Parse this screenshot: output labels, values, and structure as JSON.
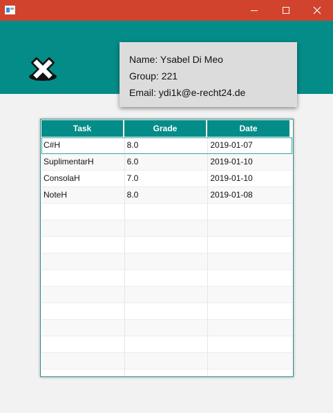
{
  "window": {
    "controls": {
      "minimize": "minimize-icon",
      "maximize": "maximize-icon",
      "close": "close-icon"
    }
  },
  "header": {
    "logo_icon": "x-mark-logo-icon",
    "accent_color": "#048c88",
    "titlebar_color": "#d1432c"
  },
  "student": {
    "name": "Name: Ysabel Di Meo",
    "group": "Group: 221",
    "email": "Email: ydi1k@e-recht24.de"
  },
  "table": {
    "columns": [
      "Task",
      "Grade",
      "Date"
    ],
    "rows": [
      {
        "task": "C#H",
        "grade": "8.0",
        "date": "2019-01-07"
      },
      {
        "task": "SuplimentarH",
        "grade": "6.0",
        "date": "2019-01-10"
      },
      {
        "task": "ConsolaH",
        "grade": "7.0",
        "date": "2019-01-10"
      },
      {
        "task": "NoteH",
        "grade": "8.0",
        "date": "2019-01-08"
      }
    ],
    "selected_row": 0
  }
}
